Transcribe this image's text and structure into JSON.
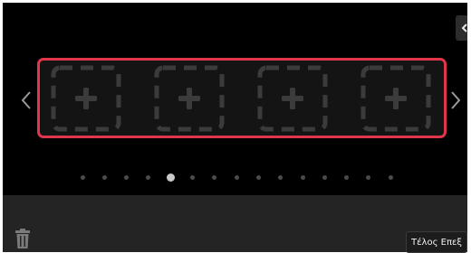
{
  "app": {
    "icons": {
      "collapse": "chevron-left-icon",
      "prev": "chevron-left-icon",
      "next": "chevron-right-icon",
      "slot": "plus-icon",
      "trash": "trash-icon"
    },
    "colors": {
      "background": "#000000",
      "selection_border": "#e0364a",
      "slot_dashes": "#3b3b3b",
      "bottom_bar": "#242424"
    }
  },
  "slots": [
    {
      "state": "empty",
      "icon": "plus-icon"
    },
    {
      "state": "empty",
      "icon": "plus-icon"
    },
    {
      "state": "empty",
      "icon": "plus-icon"
    },
    {
      "state": "empty",
      "icon": "plus-icon"
    }
  ],
  "pagination": {
    "page_count": 15,
    "current_page": 5
  },
  "footer": {
    "done_label": "Τέλος Επεξ"
  }
}
